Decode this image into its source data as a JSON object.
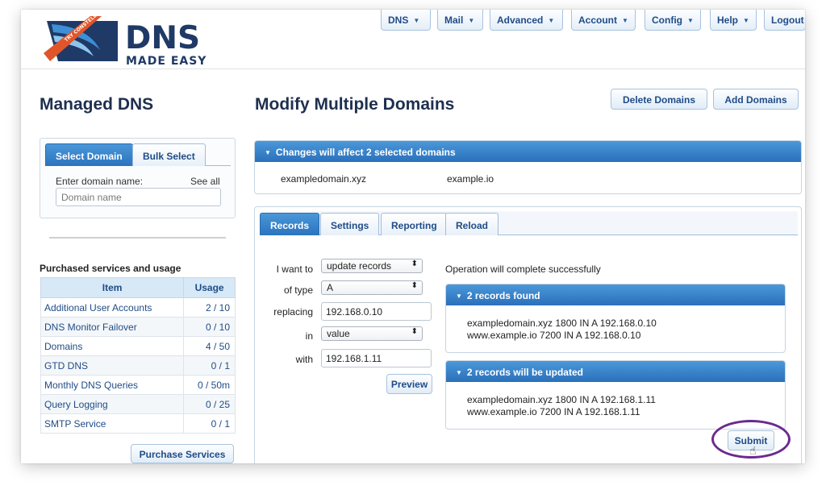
{
  "brand": {
    "word": "DNS",
    "sub": "MADE EASY",
    "ribbon": "TRY CONSTELLIX",
    "primary_color": "#1f3a66",
    "accent_color": "#e0562a"
  },
  "nav": {
    "items": [
      {
        "label": "DNS",
        "dropdown": true
      },
      {
        "label": "Mail",
        "dropdown": true
      },
      {
        "label": "Advanced",
        "dropdown": true
      },
      {
        "label": "Account",
        "dropdown": true
      },
      {
        "label": "Config",
        "dropdown": true
      },
      {
        "label": "Help",
        "dropdown": true
      },
      {
        "label": "Logout",
        "dropdown": false
      }
    ]
  },
  "left": {
    "title": "Managed DNS",
    "tabs": [
      "Select Domain",
      "Bulk Select"
    ],
    "enter_label": "Enter domain name:",
    "see_all": "See all",
    "domain_placeholder": "Domain name",
    "purchased_title": "Purchased services and usage",
    "table": {
      "headers": [
        "Item",
        "Usage"
      ],
      "rows": [
        {
          "item": "Additional User Accounts",
          "usage": "2 / 10"
        },
        {
          "item": "DNS Monitor Failover",
          "usage": "0 / 10"
        },
        {
          "item": "Domains",
          "usage": "4 / 50"
        },
        {
          "item": "GTD DNS",
          "usage": "0 / 1"
        },
        {
          "item": "Monthly DNS Queries",
          "usage": "0 / 50m"
        },
        {
          "item": "Query Logging",
          "usage": "0 / 25"
        },
        {
          "item": "SMTP Service",
          "usage": "0 / 1"
        }
      ]
    },
    "purchase_button": "Purchase Services"
  },
  "main": {
    "title": "Modify Multiple Domains",
    "delete_button": "Delete Domains",
    "add_button": "Add Domains",
    "changes_header": "Changes will affect 2 selected domains",
    "selected_domains": [
      "exampledomain.xyz",
      "example.io"
    ],
    "tabs": [
      "Records",
      "Settings",
      "Reporting",
      "Reload"
    ],
    "form": {
      "want_label": "I want to",
      "want_value": "update records",
      "type_label": "of type",
      "type_value": "A",
      "replacing_label": "replacing",
      "replacing_value": "192.168.0.10",
      "in_label": "in",
      "in_value": "value",
      "with_label": "with",
      "with_value": "192.168.1.11",
      "preview_button": "Preview"
    },
    "operation_text": "Operation will complete successfully",
    "found": {
      "header": "2 records found",
      "lines": [
        "exampledomain.xyz 1800 IN A 192.168.0.10",
        "www.example.io 7200 IN A 192.168.0.10"
      ]
    },
    "updated": {
      "header": "2 records will be updated",
      "lines": [
        "exampledomain.xyz 1800 IN A 192.168.1.11",
        "www.example.io 7200 IN A 192.168.1.11"
      ]
    },
    "submit_button": "Submit",
    "highlight_color": "#6b2a8f"
  }
}
